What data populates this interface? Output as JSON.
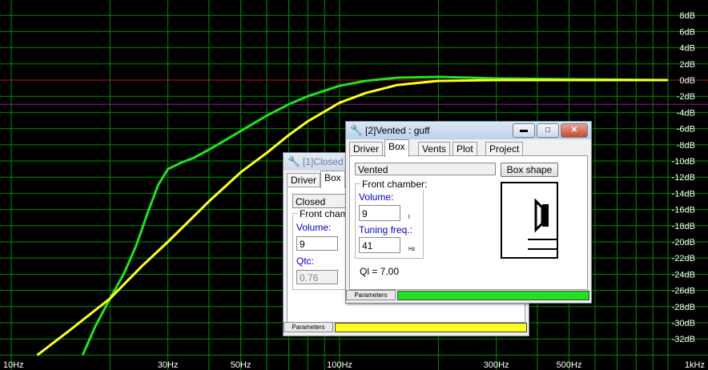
{
  "colors": {
    "background": "#000000",
    "grid": "#008c00",
    "reference_line": "#c01818",
    "minus3_line": "#a0109a",
    "vented_curve": "#22e022",
    "closed_curve": "#ffff20",
    "axis_text": "#ffffff"
  },
  "chart_data": {
    "type": "line",
    "x_scale": "log",
    "xlim": [
      10,
      1000
    ],
    "ylim": [
      -34,
      10
    ],
    "x_tick_labels": [
      "10Hz",
      "30Hz",
      "50Hz",
      "100Hz",
      "300Hz",
      "500Hz",
      "1kHz"
    ],
    "y_tick_labels": [
      "8dB",
      "6dB",
      "4dB",
      "2dB",
      "0dB",
      "-2dB",
      "-4dB",
      "-6dB",
      "-8dB",
      "-10dB",
      "-12dB",
      "-14dB",
      "-16dB",
      "-18dB",
      "-20dB",
      "-22dB",
      "-24dB",
      "-26dB",
      "-28dB",
      "-30dB",
      "-32dB"
    ],
    "reference_lines": [
      0,
      -3
    ],
    "series": [
      {
        "color": "#22e022",
        "x": [
          16.5,
          18,
          20,
          22,
          24,
          26,
          28,
          30,
          33,
          36,
          40,
          45,
          50,
          60,
          70,
          80,
          100,
          120,
          150,
          200,
          250,
          300,
          500,
          1000
        ],
        "y": [
          -34,
          -30.5,
          -27,
          -24,
          -20.5,
          -16.5,
          -13,
          -11,
          -10.2,
          -9.6,
          -8.6,
          -7.4,
          -6.3,
          -4.4,
          -3,
          -2,
          -0.7,
          -0.1,
          0.3,
          0.4,
          0.3,
          0.2,
          0.1,
          0
        ]
      },
      {
        "color": "#ffff20",
        "x": [
          12,
          15,
          20,
          25,
          30,
          40,
          50,
          60,
          70,
          80,
          100,
          120,
          150,
          200,
          300,
          500,
          1000
        ],
        "y": [
          -34,
          -31,
          -27,
          -23,
          -20,
          -15,
          -11.4,
          -9,
          -6.8,
          -5.1,
          -2.8,
          -1.6,
          -0.6,
          -0.1,
          0,
          0,
          0
        ]
      }
    ]
  },
  "closed_window": {
    "title": "[1]Closed : ...",
    "tabs": [
      "Driver",
      "Box"
    ],
    "type_value": "Closed",
    "group_label": "Front chamber:",
    "volume_label": "Volume:",
    "volume_value": "9",
    "qtc_label": "Qtc:",
    "qtc_value": "0.76",
    "status_tab": "Parameters",
    "status_color": "#ffff20"
  },
  "vented_window": {
    "title": "[2]Vented : guff",
    "tabs": [
      "Driver",
      "Box",
      "Vents",
      "Plot",
      "Project"
    ],
    "type_value": "Vented",
    "box_shape_button": "Box shape",
    "group_label": "Front chamber:",
    "volume_label": "Volume:",
    "volume_value": "9",
    "volume_unit": "l",
    "tuning_label": "Tuning freq.:",
    "tuning_value": "41",
    "tuning_unit": "Hz",
    "ql_text": "Ql = 7.00",
    "status_tab": "Parameters",
    "status_color": "#22e022"
  },
  "icons": {
    "app_icon": "wrench-icon",
    "minimize": "minimize-icon",
    "maximize": "maximize-icon",
    "close": "close-icon",
    "box_diagram": "speaker-box-icon"
  }
}
